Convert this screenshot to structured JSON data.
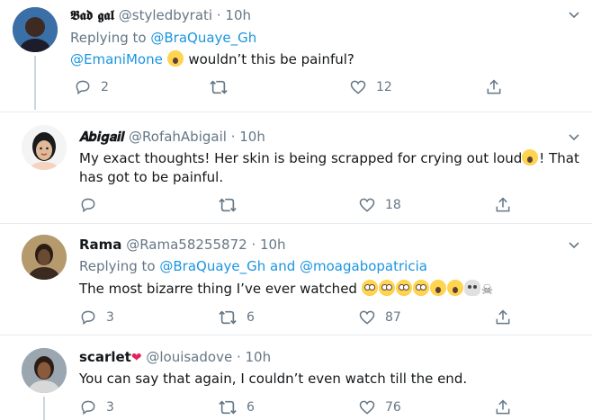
{
  "tweets": [
    {
      "display_name": "𝕭𝖆𝖉 𝖌𝖆𝖑",
      "handle": "@styledbyrati",
      "time": "· 10h",
      "replying_prefix": "Replying to",
      "replying_to": "@BraQuaye_Gh",
      "mention": "@EmaniMone",
      "text": " wouldn’t this be painful?",
      "replies": "2",
      "retweets": "",
      "likes": "12"
    },
    {
      "display_name": "𝑨𝒃𝒊𝒈𝒂𝒊𝒍",
      "handle": "@RofahAbigail",
      "time": "· 10h",
      "text_1": "My exact thoughts! Her skin is being scrapped for crying out loud",
      "text_2": "! That",
      "text_3": "has got to be painful.",
      "replies": "",
      "retweets": "",
      "likes": "18"
    },
    {
      "display_name": "Rama",
      "handle": "@Rama58255872",
      "time": "· 10h",
      "replying_prefix": "Replying to",
      "replying_to_1": "@BraQuaye_Gh",
      "replying_and": " and ",
      "replying_to_2": "@moagabopatricia",
      "text": "The most bizarre thing I’ve ever watched ",
      "replies": "3",
      "retweets": "6",
      "likes": "87"
    },
    {
      "display_name": "scarlet",
      "name_emoji": "❤",
      "handle": "@louisadove",
      "time": "· 10h",
      "text": "You can say that again, I couldn’t even watch till the end.",
      "replies": "3",
      "retweets": "6",
      "likes": "76"
    }
  ],
  "icons": {
    "reply": "reply-icon",
    "retweet": "retweet-icon",
    "like": "heart-icon",
    "share": "share-icon",
    "menu": "chevron-down-icon"
  },
  "colors": {
    "link": "#1b95e0",
    "meta": "#657786",
    "divider": "#e6ecf0",
    "thread_line": "#ccd6dd"
  }
}
